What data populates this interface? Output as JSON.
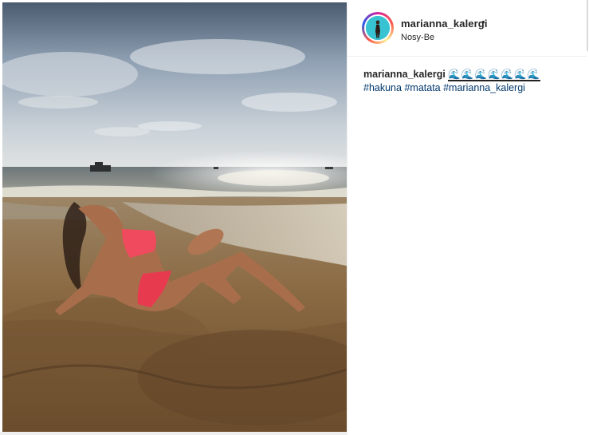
{
  "post": {
    "username": "marianna_kalergi",
    "separator": "•",
    "location": "Nosy-Be",
    "caption": {
      "username": "marianna_kalergi",
      "emojis": "🌊🌊🌊🌊🌊🌊🌊",
      "hashtags": [
        "#hakuna",
        "#matata",
        "#marianna_kalergi"
      ]
    },
    "image_subject": "photo-of-woman-on-beach",
    "avatar": "profile-picture",
    "colors": {
      "link": "#00376b",
      "text": "#262626",
      "ring_gradient": [
        "#d6249f",
        "#fd5949",
        "#fdf497",
        "#285AEB"
      ]
    }
  }
}
